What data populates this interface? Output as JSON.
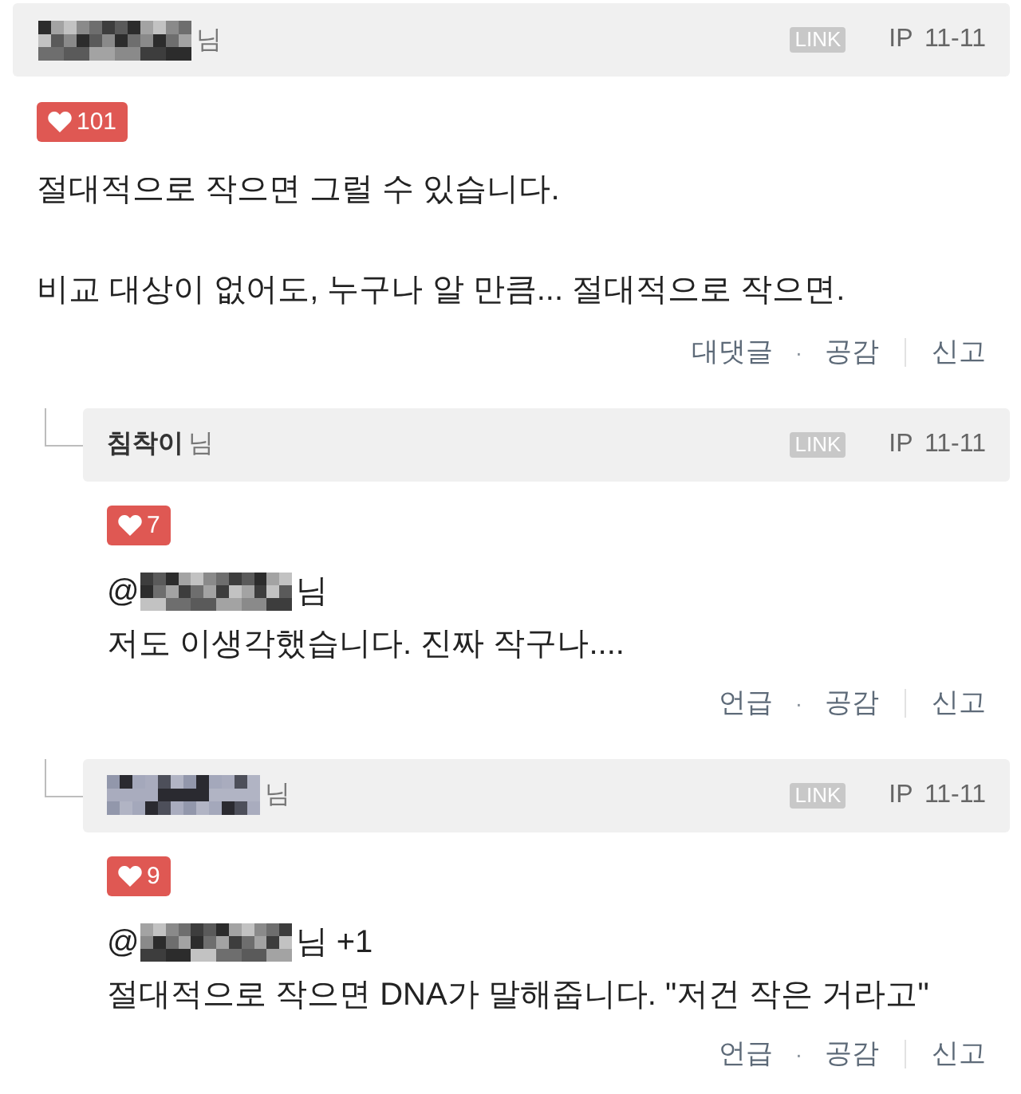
{
  "comments": [
    {
      "author": {
        "redacted": true,
        "suffix": "님"
      },
      "link": "LINK",
      "ip": "IP 11-11",
      "likes": "101",
      "body": [
        "절대적으로 작으면 그럴 수 있습니다.",
        "비교 대상이 없어도, 누구나 알 만큼... 절대적으로 작으면."
      ],
      "actions": [
        "대댓글",
        "공감"
      ],
      "separator": "·",
      "report": "신고",
      "replies": [
        {
          "author": {
            "redacted": false,
            "name": "침착이",
            "suffix": "님"
          },
          "link": "LINK",
          "ip": "IP 11-11",
          "likes": "7",
          "mention": {
            "prefix": "@",
            "redacted": true,
            "suffix": "님"
          },
          "body": [
            "저도 이생각했습니다. 진짜 작구나...."
          ],
          "actions": [
            "언급",
            "공감"
          ],
          "separator": "·",
          "report": "신고"
        },
        {
          "author": {
            "redacted": true,
            "suffix": "님"
          },
          "link": "LINK",
          "ip": "IP 11-11",
          "likes": "9",
          "mention": {
            "prefix": "@",
            "redacted": true,
            "suffix": "님 +1"
          },
          "body": [
            "절대적으로 작으면 DNA가 말해줍니다. \"저건 작은 거라고\""
          ],
          "actions": [
            "언급",
            "공감"
          ],
          "separator": "·",
          "report": "신고"
        }
      ]
    }
  ]
}
